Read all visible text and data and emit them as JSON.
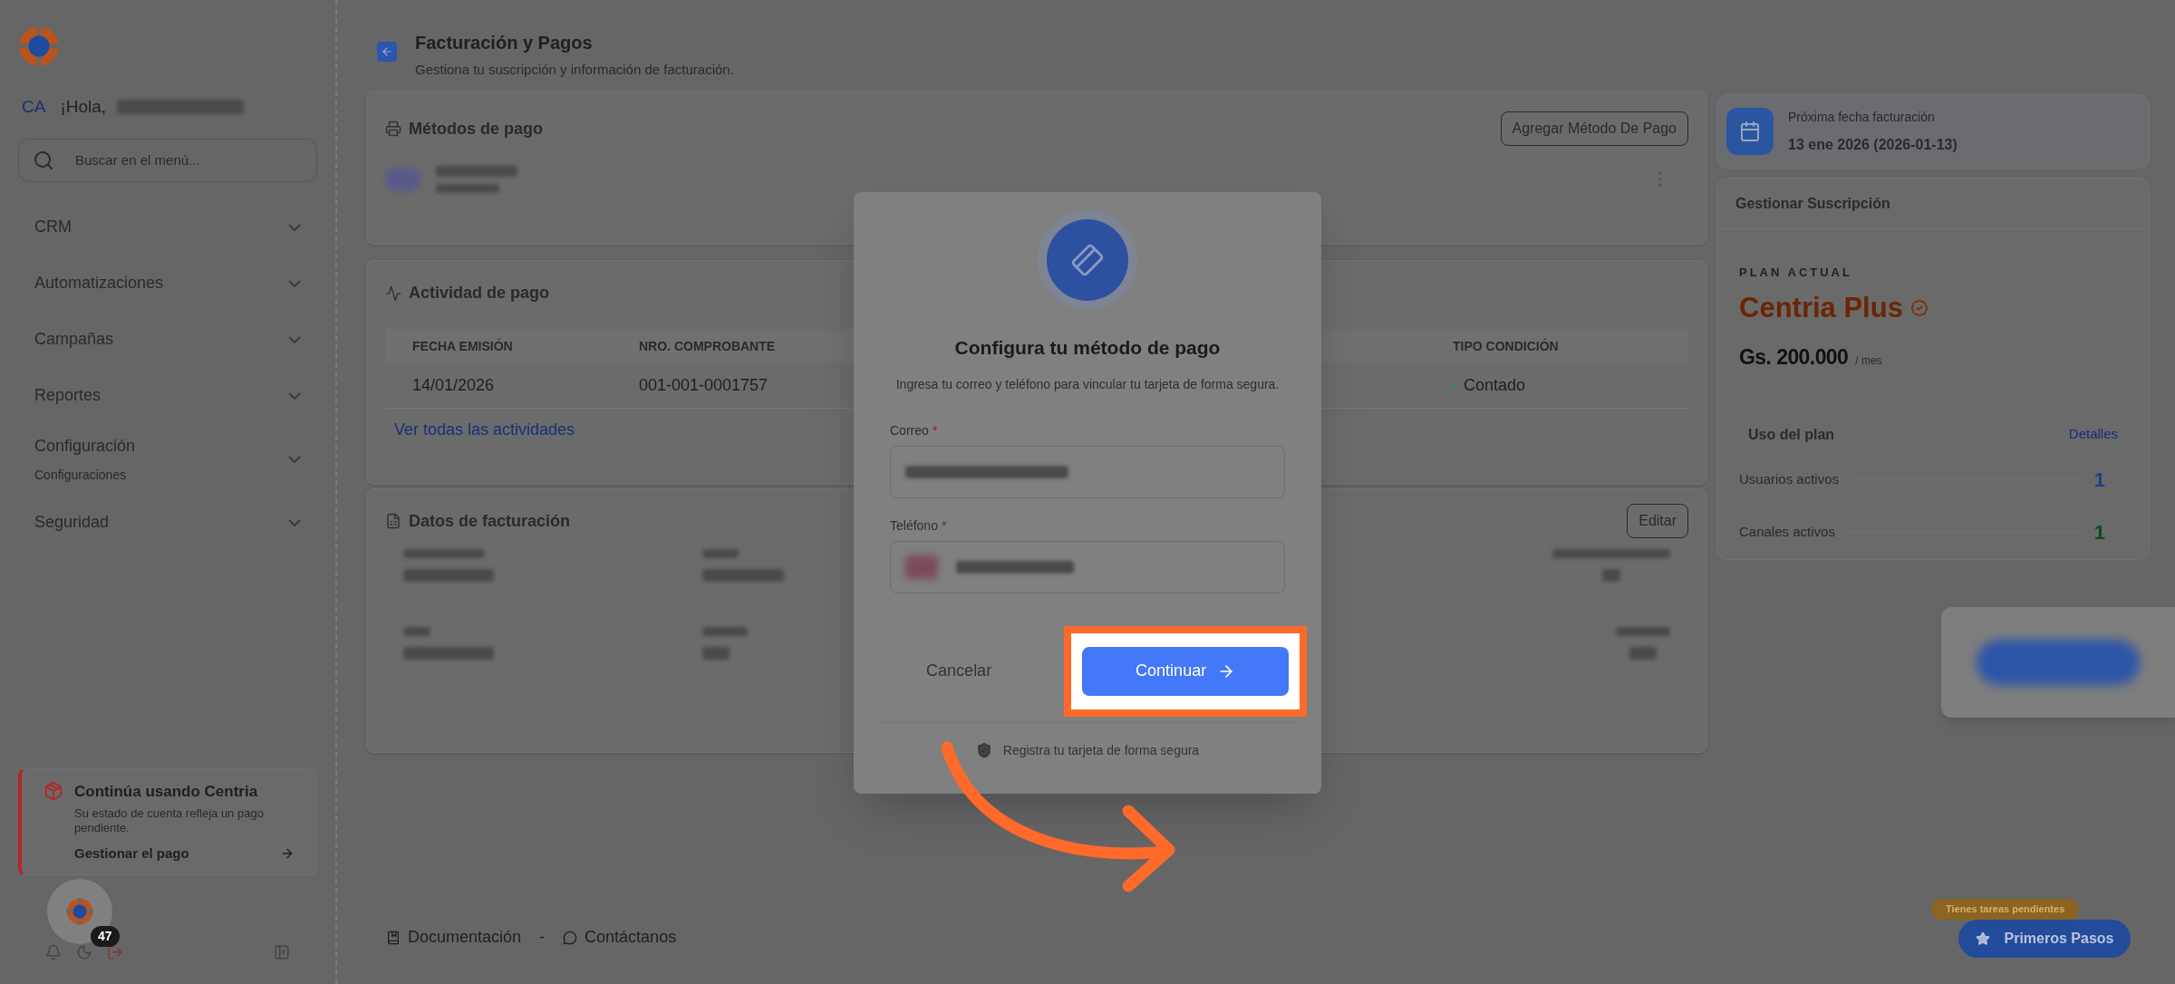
{
  "sidebar": {
    "avatar_initials": "CA",
    "greeting": "¡Hola,",
    "search": {
      "placeholder": "Buscar en el menú..."
    },
    "menu": [
      {
        "label": "CRM"
      },
      {
        "label": "Automatizaciones"
      },
      {
        "label": "Campañas"
      },
      {
        "label": "Reportes"
      },
      {
        "label": "Configuración",
        "sublabel": "Configuraciones"
      },
      {
        "label": "Seguridad"
      }
    ],
    "alert": {
      "title": "Continúa usando Centria",
      "message": "Su estado de cuenta refleja un pago pendiente.",
      "link": "Gestionar el pago"
    },
    "notification_count": "47"
  },
  "header": {
    "title": "Facturación y Pagos",
    "subtitle": "Gestiona tu suscripción y información de facturación."
  },
  "payment_methods": {
    "title": "Métodos de pago",
    "add_button": "Agregar Método De Pago"
  },
  "payment_activity": {
    "title": "Actividad de pago",
    "columns": [
      "FECHA EMISIÓN",
      "NRO. COMPROBANTE",
      "TIPO CONDICIÓN"
    ],
    "rows": [
      {
        "cells": [
          "14/01/2026",
          "001-001-0001757",
          "Contado"
        ],
        "color": "#2f8a4f"
      }
    ],
    "link": "Ver todas las actividades"
  },
  "billing_data": {
    "title": "Datos de facturación",
    "edit_button": "Editar"
  },
  "footer": {
    "docs": "Documentación",
    "separator": "-",
    "contact": "Contáctanos"
  },
  "next_billing": {
    "label": "Próxima fecha facturación",
    "date": "13 ene 2026 (2026-01-13)"
  },
  "subscription": {
    "title": "Gestionar Suscripción",
    "plan_label": "PLAN ACTUAL",
    "plan_name": "Centria Plus",
    "price": "Gs. 200.000",
    "period": "/ mes",
    "usage_title": "Uso del plan",
    "details_link": "Detalles",
    "usage": [
      {
        "label": "Usuarios activos",
        "value": "1",
        "color": "#1f3f8c"
      },
      {
        "label": "Canales activos",
        "value": "1",
        "color": "#0c4a24"
      }
    ]
  },
  "modal": {
    "title": "Configura tu método de pago",
    "subtitle": "Ingresa tu correo y teléfono para vincular tu tarjeta de forma segura.",
    "fields": [
      {
        "label": "Correo",
        "marker": "*",
        "kind": "email"
      },
      {
        "label": "Teléfono",
        "marker": "*",
        "kind": "phone"
      }
    ],
    "cancel": "Cancelar",
    "continue": "Continuar",
    "continue_highlighted": true,
    "note": "Registra tu tarjeta de forma segura"
  },
  "tasks_badge": "Tienes tareas pendientes",
  "first_steps": "Primeros Pasos"
}
